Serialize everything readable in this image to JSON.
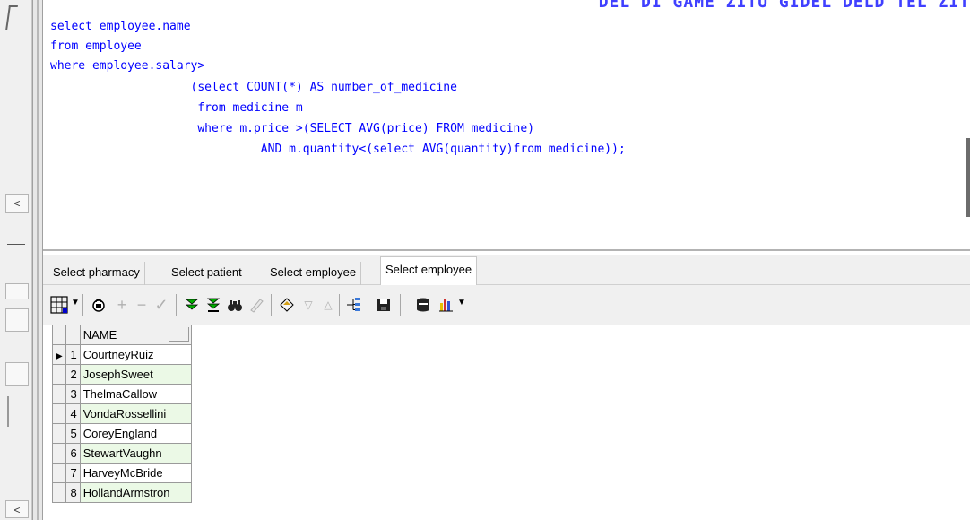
{
  "editor": {
    "banner": "DEL DI GAME ZITU GIDEL DELD TEL ZIT",
    "lines": [
      "select employee.name",
      "from employee",
      "where employee.salary>",
      "                    (select COUNT(*) AS number_of_medicine",
      "                     from medicine m",
      "                     where m.price >(SELECT AVG(price) FROM medicine)",
      "                              AND m.quantity<(select AVG(quantity)from medicine));"
    ]
  },
  "tabs": [
    {
      "label": "Select pharmacy"
    },
    {
      "label": "Select patient"
    },
    {
      "label": "Select employee"
    },
    {
      "label": "Select employee",
      "active": true
    }
  ],
  "toolbar": {
    "icons": [
      "grid-view-icon",
      "lock-icon",
      "add-icon",
      "remove-icon",
      "check-icon",
      "next-page-icon",
      "last-page-icon",
      "binoculars-icon",
      "clear-icon",
      "fill-icon",
      "sort-desc-icon",
      "sort-asc-icon",
      "tree-icon",
      "save-icon",
      "database-icon",
      "chart-icon"
    ]
  },
  "grid": {
    "header": "NAME",
    "rows": [
      {
        "num": "1",
        "name": "CourtneyRuiz"
      },
      {
        "num": "2",
        "name": "JosephSweet"
      },
      {
        "num": "3",
        "name": "ThelmaCallow"
      },
      {
        "num": "4",
        "name": "VondaRossellini"
      },
      {
        "num": "5",
        "name": "CoreyEngland"
      },
      {
        "num": "6",
        "name": "StewartVaughn"
      },
      {
        "num": "7",
        "name": "HarveyMcBride"
      },
      {
        "num": "8",
        "name": "HollandArmstron"
      }
    ]
  },
  "gutter": {
    "collapse_top": "<",
    "collapse_bottom": "<"
  }
}
